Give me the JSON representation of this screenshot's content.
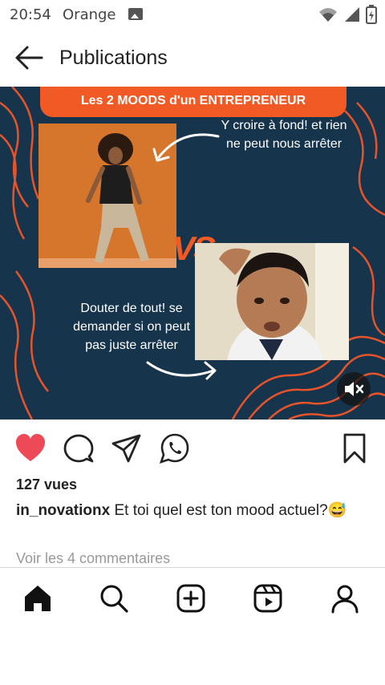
{
  "status_bar": {
    "time": "20:54",
    "carrier": "Orange"
  },
  "header": {
    "title": "Publications"
  },
  "post": {
    "banner_text": "Les 2 MOODS d'un ENTREPRENEUR",
    "caption_top": "Y croire à fond! et rien ne peut nous arrêter",
    "caption_bottom": "Douter de tout! se demander si on peut pas juste arrêter",
    "vs_text": "VS",
    "accent_color": "#f15a24",
    "background_color": "#17344d"
  },
  "actions": {
    "liked": true,
    "like_color": "#ed4956"
  },
  "meta": {
    "views": "127 vues",
    "username": "in_novationx",
    "caption": " Et toi quel est ton mood actuel?😅",
    "comments_link": "Voir les 4 commentaires"
  },
  "bottom_nav": {
    "items": [
      "home-icon",
      "search-icon",
      "add-icon",
      "reels-icon",
      "profile-icon"
    ]
  }
}
